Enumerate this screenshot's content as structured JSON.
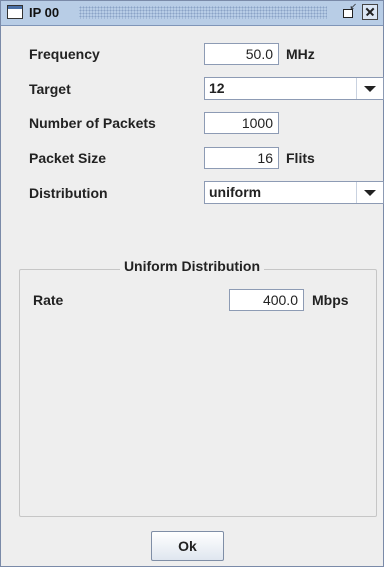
{
  "window": {
    "title": "IP 00"
  },
  "form": {
    "frequency": {
      "label": "Frequency",
      "value": "50.0",
      "unit": "MHz"
    },
    "target": {
      "label": "Target",
      "selected": "12"
    },
    "packets": {
      "label": "Number of Packets",
      "value": "1000"
    },
    "packet_size": {
      "label": "Packet Size",
      "value": "16",
      "unit": "Flits"
    },
    "distribution": {
      "label": "Distribution",
      "selected": "uniform"
    }
  },
  "group": {
    "title": "Uniform Distribution",
    "rate": {
      "label": "Rate",
      "value": "400.0",
      "unit": "Mbps"
    }
  },
  "buttons": {
    "ok": "Ok"
  }
}
